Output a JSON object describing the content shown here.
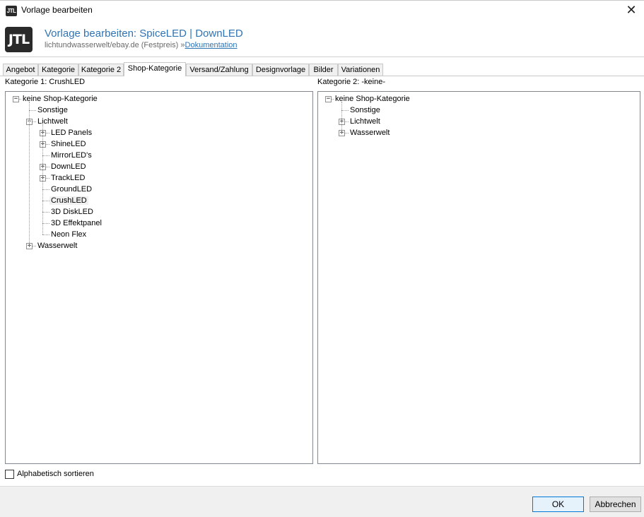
{
  "window": {
    "title": "Vorlage bearbeiten",
    "app_icon": "JTL",
    "close_symbol": "✕"
  },
  "header": {
    "logo_text": "JTL",
    "title": "Vorlage bearbeiten: SpiceLED | DownLED",
    "subtitle": "lichtundwasserwelt/ebay.de (Festpreis)",
    "separator": "»",
    "doc_link": "Dokumentation"
  },
  "tabs": [
    {
      "label": "Angebot",
      "active": false
    },
    {
      "label": "Kategorie",
      "active": false
    },
    {
      "label": "Kategorie 2",
      "active": false
    },
    {
      "label": "Shop-Kategorie",
      "active": true
    },
    {
      "label": "Versand/Zahlung",
      "active": false
    },
    {
      "label": "Designvorlage",
      "active": false
    },
    {
      "label": "Bilder",
      "active": false
    },
    {
      "label": "Variationen",
      "active": false
    }
  ],
  "left_panel": {
    "label": "Kategorie 1: CrushLED",
    "tree": [
      {
        "label": "keine Shop-Kategorie",
        "level": 0,
        "toggle": "-",
        "selected": false
      },
      {
        "label": "Sonstige",
        "level": 1,
        "toggle": "",
        "selected": false
      },
      {
        "label": "Lichtwelt",
        "level": 1,
        "toggle": "-",
        "selected": false
      },
      {
        "label": "LED Panels",
        "level": 2,
        "toggle": "+",
        "selected": false
      },
      {
        "label": "ShineLED",
        "level": 2,
        "toggle": "+",
        "selected": false
      },
      {
        "label": "MirrorLED's",
        "level": 2,
        "toggle": "",
        "selected": false
      },
      {
        "label": "DownLED",
        "level": 2,
        "toggle": "+",
        "selected": false
      },
      {
        "label": "TrackLED",
        "level": 2,
        "toggle": "+",
        "selected": false
      },
      {
        "label": "GroundLED",
        "level": 2,
        "toggle": "",
        "selected": false
      },
      {
        "label": "CrushLED",
        "level": 2,
        "toggle": "",
        "selected": true
      },
      {
        "label": "3D DiskLED",
        "level": 2,
        "toggle": "",
        "selected": false
      },
      {
        "label": "3D Effektpanel",
        "level": 2,
        "toggle": "",
        "selected": false
      },
      {
        "label": "Neon Flex",
        "level": 2,
        "toggle": "",
        "selected": false
      },
      {
        "label": "Wasserwelt",
        "level": 1,
        "toggle": "+",
        "selected": false
      }
    ]
  },
  "right_panel": {
    "label": "Kategorie 2: -keine-",
    "tree": [
      {
        "label": "keine Shop-Kategorie",
        "level": 0,
        "toggle": "-",
        "selected": false
      },
      {
        "label": "Sonstige",
        "level": 1,
        "toggle": "",
        "selected": false
      },
      {
        "label": "Lichtwelt",
        "level": 1,
        "toggle": "+",
        "selected": false
      },
      {
        "label": "Wasserwelt",
        "level": 1,
        "toggle": "+",
        "selected": false
      }
    ]
  },
  "sort_checkbox": {
    "label": "Alphabetisch sortieren",
    "checked": false
  },
  "buttons": {
    "ok": "OK",
    "cancel": "Abbrechen"
  }
}
